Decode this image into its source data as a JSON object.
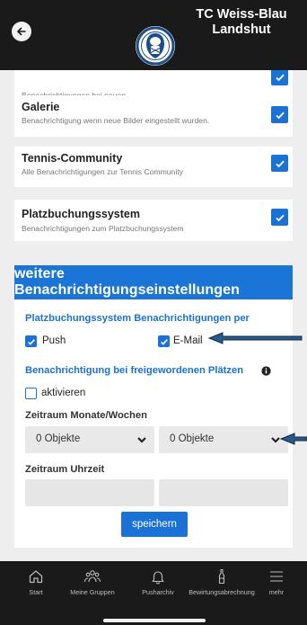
{
  "header": {
    "title_line1": "TC Weiss-Blau",
    "title_line2": "Landshut",
    "back_icon": "arrow-left-icon",
    "logo_icon": "club-logo"
  },
  "notifications": [
    {
      "title": "",
      "description": "Benachrichtigungen bei neuen",
      "checked": true
    },
    {
      "title": "Galerie",
      "description": "Benachrichtigung wenn neue Bilder eingestellt wurden.",
      "checked": true
    },
    {
      "title": "Tennis-Community",
      "description": "Alle Benachrichtigungen zur Tennis Community",
      "checked": true
    },
    {
      "title": "Platzbuchungssystem",
      "description": "Benachrichtigungen zum Platzbuchungssystem",
      "checked": true
    }
  ],
  "banner": {
    "label": "weitere Benachrichtigungseinstellungen"
  },
  "settings": {
    "booking_heading": "Platzbuchungssystem Benachrichtigungen per",
    "push_label": "Push",
    "push_checked": true,
    "email_label": "E-Mail",
    "email_checked": true,
    "free_courts_heading": "Benachrichtigung bei freigewordenen Plätzen",
    "info_icon": "info-circle-icon",
    "activate_label": "aktivieren",
    "activate_checked": false,
    "period_heading": "Zeitraum Monate/Wochen",
    "select_months": "0 Objekte",
    "select_weeks": "0 Objekte",
    "time_heading": "Zeitraum Uhrzeit",
    "time_from": "",
    "time_to": "",
    "save_label": "speichern"
  },
  "bottom_nav": [
    {
      "label": "Start",
      "icon": "home-icon"
    },
    {
      "label": "Meine Gruppen",
      "icon": "group-icon"
    },
    {
      "label": "Pusharchiv",
      "icon": "bell-icon"
    },
    {
      "label": "Bewirtungsabrechnung",
      "icon": "bottle-icon"
    },
    {
      "label": "mehr",
      "icon": "menu-icon"
    }
  ],
  "colors": {
    "accent": "#1a72d6",
    "header_bg": "#1a1a1a",
    "page_bg": "#eeeeee",
    "annotation_arrow": "#2a5a8a"
  }
}
